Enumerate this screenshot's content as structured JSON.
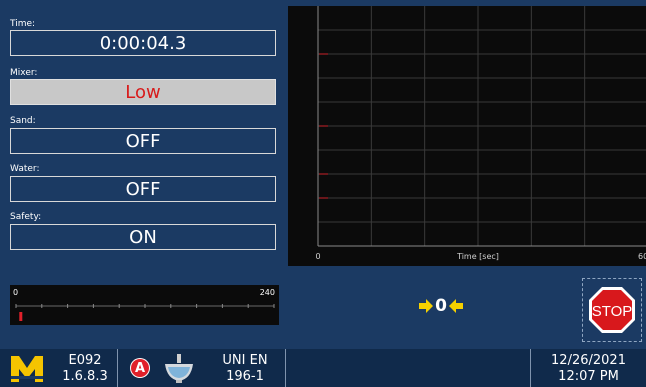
{
  "fields": {
    "time": {
      "label": "Time:",
      "value": "0:00:04.3"
    },
    "mixer": {
      "label": "Mixer:",
      "value": "Low"
    },
    "sand": {
      "label": "Sand:",
      "value": "OFF"
    },
    "water": {
      "label": "Water:",
      "value": "OFF"
    },
    "safety": {
      "label": "Safety:",
      "value": "ON"
    }
  },
  "chart_data": {
    "type": "line",
    "xlabel": "Time [sec]",
    "xlim": [
      0,
      60
    ],
    "tick_labels": {
      "x_min": "0",
      "x_max": "60"
    },
    "grid": true
  },
  "chart_icons": [
    "mixer-icon",
    "sand-icon",
    "water-drop-icon",
    "alarm-bell-icon"
  ],
  "scale": {
    "min": "0",
    "max": "240",
    "value": 4
  },
  "center_indicator": {
    "value": "0"
  },
  "stop_button": {
    "label": "STOP"
  },
  "status_bar": {
    "code": "E092",
    "version": "1.6.8.3",
    "badge": "A",
    "standard_line1": "UNI EN",
    "standard_line2": "196-1",
    "date": "12/26/2021",
    "time": "12:07 PM"
  },
  "colors": {
    "background": "#1b3a63",
    "highlight_text": "#d81b1b",
    "arrow": "#f5d000",
    "stop_red": "#d8181c"
  }
}
